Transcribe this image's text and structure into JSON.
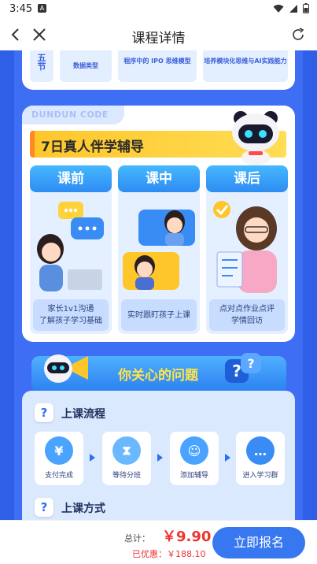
{
  "status": {
    "time": "3:45",
    "notif": "A"
  },
  "nav": {
    "title": "课程详情"
  },
  "top_cards": [
    {
      "text": "五\n节"
    },
    {
      "text": "数据类型"
    },
    {
      "text": "程序中的 IPO 思维模型"
    },
    {
      "text": "培养模块化思维与AI实践能力"
    }
  ],
  "tutor": {
    "brand": "DUNDUN CODE",
    "banner": "7日真人伴学辅导",
    "phases": [
      {
        "title": "课前",
        "desc": "家长1v1沟通\n了解孩子学习基础"
      },
      {
        "title": "课中",
        "desc": "实时跟盯孩子上课"
      },
      {
        "title": "课后",
        "desc": "点对点作业点评\n学情回访"
      }
    ]
  },
  "faq": {
    "title": "你关心的问题",
    "flow_title": "上课流程",
    "steps": [
      {
        "label": "支付完成",
        "icon": "¥"
      },
      {
        "label": "等待分班",
        "icon": "⧗"
      },
      {
        "label": "添加辅导",
        "icon": "☺"
      },
      {
        "label": "进入学习群",
        "icon": "…"
      }
    ],
    "method_title": "上课方式"
  },
  "checkout": {
    "total_label": "总计：",
    "price": "￥9.90",
    "discount": "已优惠：￥188.10",
    "cta": "立即报名"
  },
  "colors": {
    "primary": "#3777f0",
    "price": "#ee3333",
    "banner": "#ffc62a"
  }
}
